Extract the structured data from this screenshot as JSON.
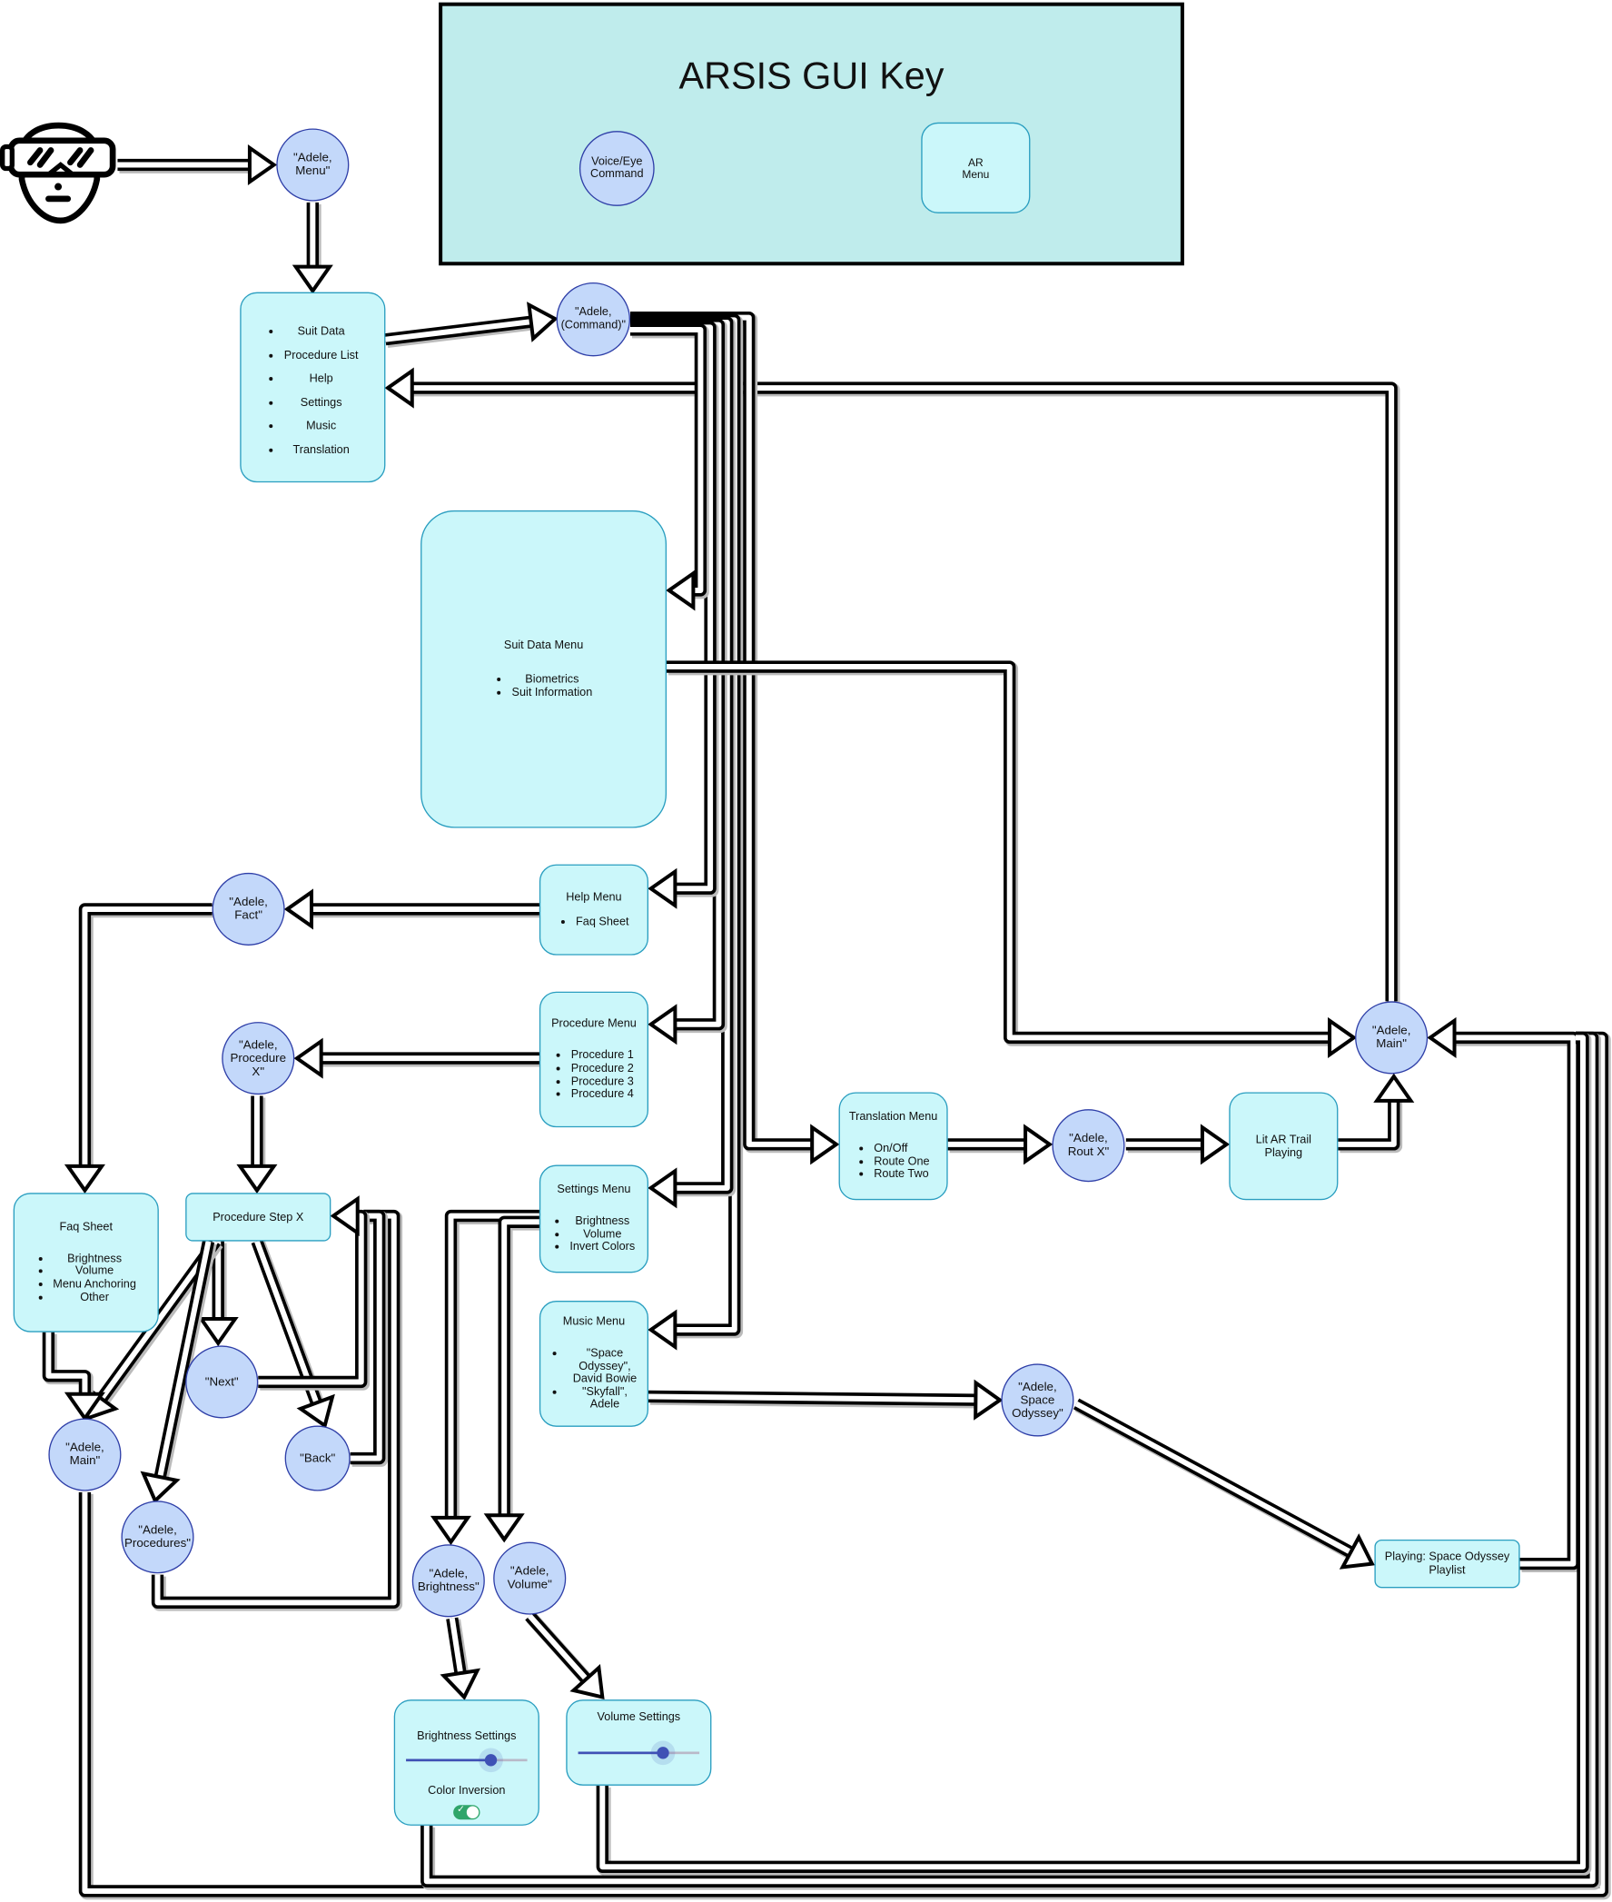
{
  "key": {
    "title": "ARSIS GUI Key",
    "voice_label": "Voice/Eye\nCommand",
    "ar_label": "AR\nMenu"
  },
  "colors": {
    "key_bg": "#bfecec",
    "menu_fill": "#cbf7fa",
    "menu_border": "#2a9ec0",
    "command_fill": "#c3d8fa",
    "command_border": "#2f3fa8",
    "toggle_on": "#2fa56a",
    "slider": "#3f51b5"
  },
  "icons": {
    "user": "vr-headset-person-icon"
  },
  "commands": {
    "menu": "\"Adele,\nMenu\"",
    "command": "\"Adele,\n(Command)\"",
    "fact": "\"Adele,\nFact\"",
    "procedure_x": "\"Adele,\nProcedure\nX\"",
    "next": "\"Next\"",
    "back": "\"Back\"",
    "main_left": "\"Adele,\nMain\"",
    "procedures": "\"Adele,\nProcedures\"",
    "rout_x": "\"Adele,\nRout X\"",
    "main_right": "\"Adele,\nMain\"",
    "space_odyssey": "\"Adele,\nSpace\nOdyssey\"",
    "brightness": "\"Adele,\nBrightness\"",
    "volume": "\"Adele,\nVolume\""
  },
  "main_menu": {
    "items": [
      "Suit Data",
      "Procedure List",
      "Help",
      "Settings",
      "Music",
      "Translation"
    ]
  },
  "suit_data_menu": {
    "title": "Suit Data Menu",
    "items": [
      "Biometrics",
      "Suit Information"
    ]
  },
  "help_menu": {
    "title": "Help Menu",
    "items": [
      "Faq Sheet"
    ]
  },
  "procedure_menu": {
    "title": "Procedure Menu",
    "items": [
      "Procedure 1",
      "Procedure 2",
      "Procedure 3",
      "Procedure 4"
    ]
  },
  "settings_menu": {
    "title": "Settings Menu",
    "items": [
      "Brightness",
      "Volume",
      "Invert Colors"
    ]
  },
  "music_menu": {
    "title": "Music Menu",
    "items": [
      "\"Space Odyssey\", David Bowie",
      "\"Skyfall\", Adele"
    ]
  },
  "translation_menu": {
    "title": "Translation Menu",
    "items": [
      "On/Off",
      "Route One",
      "Route Two"
    ]
  },
  "faq_sheet": {
    "title": "Faq Sheet",
    "items": [
      "Brightness",
      "Volume",
      "Menu Anchoring",
      "Other"
    ]
  },
  "procedure_step": {
    "title": "Procedure Step X"
  },
  "lit_ar_trail": {
    "title": "Lit AR Trail\nPlaying"
  },
  "playing": {
    "title": "Playing: Space Odyssey\nPlaylist"
  },
  "brightness_settings": {
    "title": "Brightness Settings",
    "slider_value": 0.7,
    "color_inversion_label": "Color Inversion",
    "color_inversion_on": true
  },
  "volume_settings": {
    "title": "Volume Settings",
    "slider_value": 0.7
  }
}
